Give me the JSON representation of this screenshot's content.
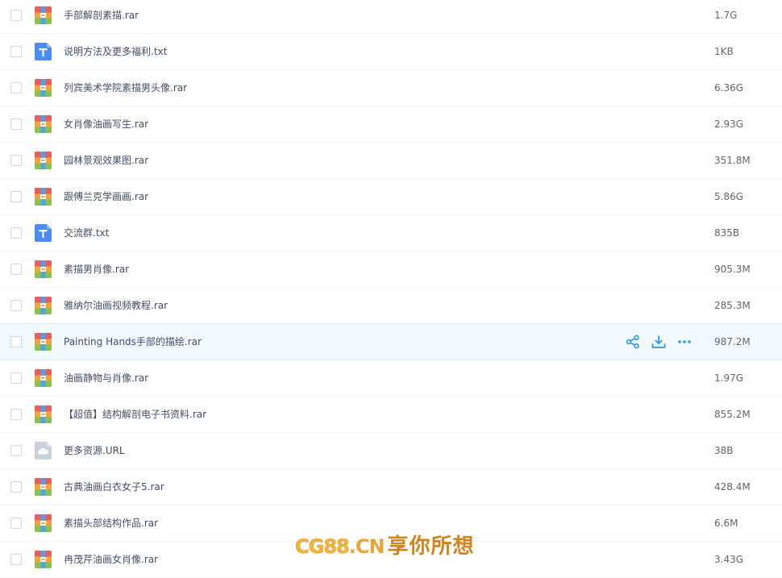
{
  "files": [
    {
      "name": "手部解剖素描.rar",
      "size": "1.7G",
      "type": "rar",
      "icon": "archive-icon"
    },
    {
      "name": "说明方法及更多福利.txt",
      "size": "1KB",
      "type": "txt",
      "icon": "text-file-icon"
    },
    {
      "name": "列宾美术学院素描男头像.rar",
      "size": "6.36G",
      "type": "rar",
      "icon": "archive-icon"
    },
    {
      "name": "女肖像油画写生.rar",
      "size": "2.93G",
      "type": "rar",
      "icon": "archive-icon"
    },
    {
      "name": "园林景观效果图.rar",
      "size": "351.8M",
      "type": "rar",
      "icon": "archive-icon"
    },
    {
      "name": "跟傅兰克学画画.rar",
      "size": "5.86G",
      "type": "rar",
      "icon": "archive-icon"
    },
    {
      "name": "交流群.txt",
      "size": "835B",
      "type": "txt",
      "icon": "text-file-icon"
    },
    {
      "name": "素描男肖像.rar",
      "size": "905.3M",
      "type": "rar",
      "icon": "archive-icon"
    },
    {
      "name": "雅纳尔油画视频教程.rar",
      "size": "285.3M",
      "type": "rar",
      "icon": "archive-icon"
    },
    {
      "name": "Painting Hands手部的描绘.rar",
      "size": "987.2M",
      "type": "rar",
      "icon": "archive-icon",
      "hovered": true
    },
    {
      "name": "油画静物与肖像.rar",
      "size": "1.97G",
      "type": "rar",
      "icon": "archive-icon"
    },
    {
      "name": "【超值】结构解剖电子书资料.rar",
      "size": "855.2M",
      "type": "rar",
      "icon": "archive-icon"
    },
    {
      "name": "更多资源.URL",
      "size": "38B",
      "type": "url",
      "icon": "cloud-file-icon"
    },
    {
      "name": "古典油画白衣女子5.rar",
      "size": "428.4M",
      "type": "rar",
      "icon": "archive-icon"
    },
    {
      "name": "素描头部结构作品.rar",
      "size": "6.6M",
      "type": "rar",
      "icon": "archive-icon"
    },
    {
      "name": "冉茂芹油画女肖像.rar",
      "size": "3.43G",
      "type": "rar",
      "icon": "archive-icon"
    }
  ],
  "row_actions": [
    {
      "icon": "share-icon",
      "name": "share-button"
    },
    {
      "icon": "download-icon",
      "name": "download-button"
    },
    {
      "icon": "more-icon",
      "name": "more-button"
    }
  ],
  "colors": {
    "action_blue": "#2a9be6",
    "txt_blue": "#4a8cf6",
    "url_gray": "#c8d0db",
    "hover_bg": "#f2f9ff"
  },
  "watermark": {
    "brand": "CG88",
    "domain": ".CN",
    "slogan": "享你所想"
  }
}
